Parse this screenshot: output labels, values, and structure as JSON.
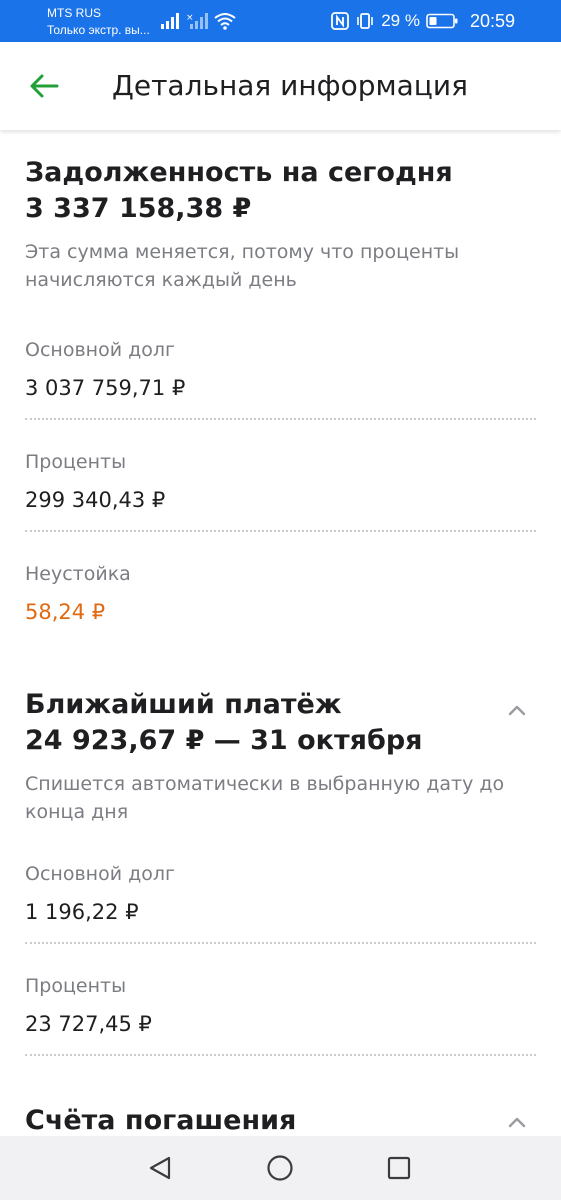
{
  "status_bar": {
    "carrier": "MTS RUS",
    "carrier_sub": "Только экстр. вы...",
    "battery_percent": "29 %",
    "time": "20:59",
    "background_color": "#1a73e8"
  },
  "header": {
    "title": "Детальная информация",
    "back_icon": "arrow-left-icon",
    "accent_color": "#21a038"
  },
  "debt": {
    "title": "Задолженность на сегодня",
    "amount": "3 337 158,38 ₽",
    "note": "Эта сумма меняется, потому что проценты начисляются каждый день",
    "rows": [
      {
        "label": "Основной долг",
        "value": "3 037 759,71 ₽"
      },
      {
        "label": "Проценты",
        "value": "299 340,43 ₽"
      },
      {
        "label": "Неустойка",
        "value": "58,24 ₽"
      }
    ],
    "penalty_color": "#e06a12"
  },
  "next_payment": {
    "title": "Ближайший платёж",
    "amount_date": "24 923,67 ₽ — 31 октября",
    "note": "Спишется автоматически в выбранную дату до конца дня",
    "rows": [
      {
        "label": "Основной долг",
        "value": "1 196,22 ₽"
      },
      {
        "label": "Проценты",
        "value": "23 727,45 ₽"
      }
    ],
    "toggle_icon": "chevron-up-icon"
  },
  "accounts": {
    "title": "Счёта погашения",
    "toggle_icon": "chevron-up-icon"
  },
  "nav_bar": {
    "back_icon": "triangle-back-icon",
    "home_icon": "circle-home-icon",
    "recents_icon": "square-recents-icon"
  }
}
